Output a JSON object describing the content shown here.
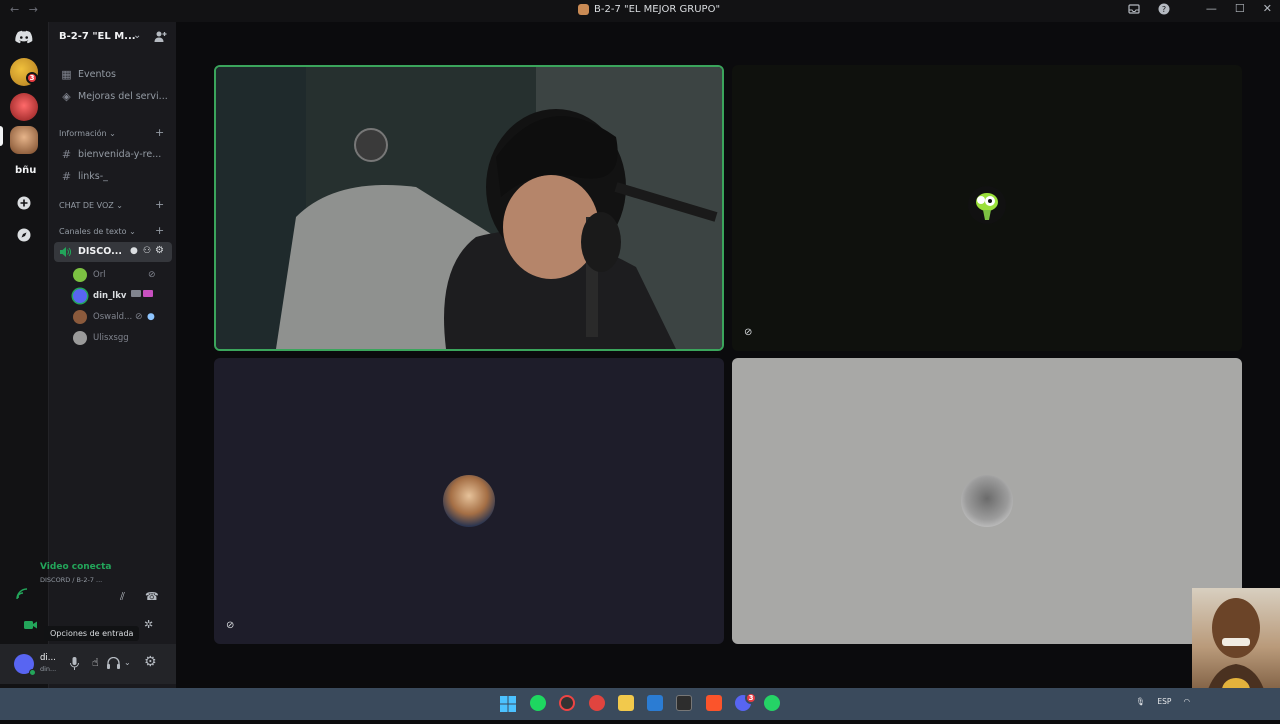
{
  "window": {
    "title": "B-2-7 \"EL MEJOR GRUPO\"",
    "nav_back": "←",
    "nav_forward": "→",
    "controls": {
      "minimize": "—",
      "maximize": "☐",
      "close": "✕"
    }
  },
  "server": {
    "name": "B-2-7 \"EL M...",
    "rail_label_bnu": "bñu",
    "mention_badge": "3"
  },
  "sidebar": {
    "top_items": [
      {
        "label": "Eventos",
        "icon": "calendar-icon"
      },
      {
        "label": "Mejoras del servi...",
        "icon": "boost-icon"
      }
    ],
    "categories": {
      "info": "Información",
      "voice": "CHAT DE VOZ",
      "text": "Canales de texto"
    },
    "text_channels": [
      {
        "label": "bienvenida-y-re..."
      },
      {
        "label": "links-_"
      }
    ],
    "voice_channel": {
      "label": "DISCO..."
    },
    "voice_users": [
      {
        "name": "Orl",
        "color": "#7cc142"
      },
      {
        "name": "din_lkv",
        "color": "#5865f2"
      },
      {
        "name": "Oswald...",
        "color": "#8b5a3c"
      },
      {
        "name": "Ulisxsgg",
        "color": "#9a9a9a"
      }
    ]
  },
  "voice_panel": {
    "status": "Video conectac",
    "subtitle": "DISCORD / B-2-7 ...",
    "tooltip": "Opciones de entrada"
  },
  "user_panel": {
    "name": "di...",
    "tag": "din..."
  },
  "taskbar": {
    "tray_language": "ESP",
    "whatsapp_badge": "3"
  },
  "colors": {
    "speaking_border": "#3ba55c",
    "connected_green": "#23a55a",
    "blurple": "#5865f2"
  }
}
